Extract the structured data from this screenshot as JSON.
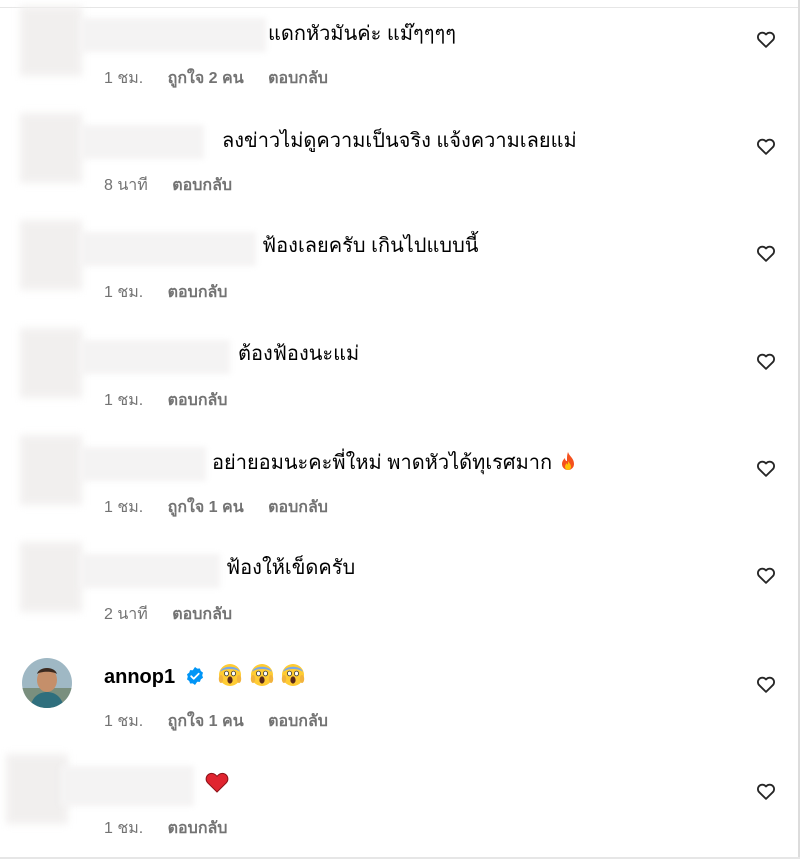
{
  "comments": [
    {
      "text": "แดกหัวมันค่ะ แม๊ๆๆๆๆ",
      "time": "1 ชม.",
      "likes": "ถูกใจ 2 คน",
      "reply": "ตอบกลับ"
    },
    {
      "text": "ลงข่าวไม่ดูความเป็นจริง แจ้งความเลยแม่",
      "time": "8 นาที",
      "likes": "",
      "reply": "ตอบกลับ"
    },
    {
      "text": "ฟ้องเลยครับ เกินไปแบบนี้",
      "time": "1 ชม.",
      "likes": "",
      "reply": "ตอบกลับ"
    },
    {
      "text": "ต้องฟ้องนะแม่",
      "time": "1 ชม.",
      "likes": "",
      "reply": "ตอบกลับ"
    },
    {
      "text": "อย่ายอมนะคะพี่ใหม่ พาดหัวได้ทุเรศมาก",
      "time": "1 ชม.",
      "likes": "ถูกใจ 1 คน",
      "reply": "ตอบกลับ"
    },
    {
      "text": "ฟ้องให้เข็ดครับ",
      "time": "2 นาที",
      "likes": "",
      "reply": "ตอบกลับ"
    },
    {
      "username": "annop1",
      "text": "",
      "time": "1 ชม.",
      "likes": "ถูกใจ 1 คน",
      "reply": "ตอบกลับ"
    },
    {
      "text": "",
      "time": "1 ชม.",
      "likes": "",
      "reply": "ตอบกลับ"
    }
  ],
  "icons": {
    "like": "heart-outline-icon",
    "verified": "verified-badge-icon",
    "fire": "fire-emoji-icon",
    "scream": "screaming-face-emoji-icon",
    "red_heart": "red-heart-emoji-icon"
  },
  "colors": {
    "text": "#000000",
    "meta": "#737373",
    "verified": "#0095f6",
    "heart_emoji": "#e0242f"
  }
}
